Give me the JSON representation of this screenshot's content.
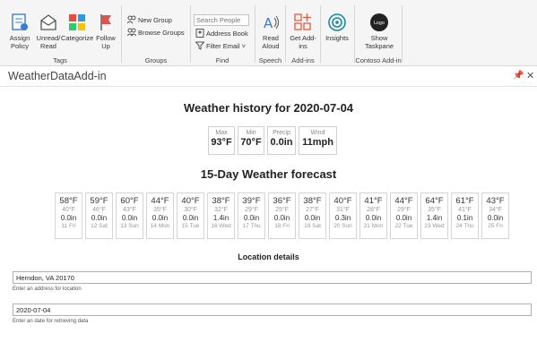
{
  "ribbon": {
    "tags": {
      "label": "Tags",
      "assign_policy": "Assign Policy",
      "unread_read": "Unread/ Read",
      "categorize": "Categorize",
      "follow_up": "Follow Up"
    },
    "groups": {
      "label": "Groups",
      "new_group": "New Group",
      "browse_groups": "Browse Groups"
    },
    "find": {
      "label": "Find",
      "search_placeholder": "Search People",
      "address_book": "Address Book",
      "filter_email": "Filter Email"
    },
    "speech": {
      "label": "Speech",
      "read_aloud": "Read Aloud"
    },
    "addins": {
      "label": "Add-ins",
      "get_addins": "Get Add-ins"
    },
    "insights": {
      "label": "Insights"
    },
    "contoso": {
      "label": "Contoso Add-in",
      "show_taskpane": "Show Taskpane",
      "logo_text": "Logo"
    }
  },
  "pane": {
    "title": "WeatherDataAdd-in"
  },
  "history": {
    "title": "Weather history for 2020-07-04",
    "stats": [
      {
        "label": "Max",
        "value": "93°F"
      },
      {
        "label": "Min",
        "value": "70°F"
      },
      {
        "label": "Precip",
        "value": "0.0in"
      },
      {
        "label": "Wind",
        "value": "11mph"
      }
    ]
  },
  "forecast": {
    "title": "15-Day Weather forecast",
    "days": [
      {
        "hi": "58°F",
        "lo": "40°F",
        "precip": "0.0in",
        "date": "11 Fri"
      },
      {
        "hi": "59°F",
        "lo": "46°F",
        "precip": "0.0in",
        "date": "12 Sat"
      },
      {
        "hi": "60°F",
        "lo": "43°F",
        "precip": "0.0in",
        "date": "13 Sun"
      },
      {
        "hi": "44°F",
        "lo": "35°F",
        "precip": "0.0in",
        "date": "14 Mon"
      },
      {
        "hi": "40°F",
        "lo": "30°F",
        "precip": "0.0in",
        "date": "15 Tue"
      },
      {
        "hi": "38°F",
        "lo": "32°F",
        "precip": "1.4in",
        "date": "16 Wed"
      },
      {
        "hi": "39°F",
        "lo": "29°F",
        "precip": "0.0in",
        "date": "17 Thu"
      },
      {
        "hi": "36°F",
        "lo": "25°F",
        "precip": "0.0in",
        "date": "18 Fri"
      },
      {
        "hi": "38°F",
        "lo": "27°F",
        "precip": "0.0in",
        "date": "19 Sat"
      },
      {
        "hi": "40°F",
        "lo": "31°F",
        "precip": "0.3in",
        "date": "20 Sun"
      },
      {
        "hi": "41°F",
        "lo": "28°F",
        "precip": "0.0in",
        "date": "21 Mon"
      },
      {
        "hi": "44°F",
        "lo": "29°F",
        "precip": "0.0in",
        "date": "22 Tue"
      },
      {
        "hi": "64°F",
        "lo": "35°F",
        "precip": "1.4in",
        "date": "23 Wed"
      },
      {
        "hi": "61°F",
        "lo": "41°F",
        "precip": "0.1in",
        "date": "24 Thu"
      },
      {
        "hi": "43°F",
        "lo": "34°F",
        "precip": "0.0in",
        "date": "25 Fri"
      }
    ]
  },
  "location": {
    "title": "Location details",
    "address_value": "Herndon, VA 20170",
    "address_hint": "Enter an address for location",
    "date_value": "2020-07-04",
    "date_hint": "Enter an date for retrieving data"
  },
  "colors": {
    "assign_policy": "#3a7bd5",
    "categorize": [
      "#e74c3c",
      "#3498db",
      "#2ecc71",
      "#f1c40f"
    ],
    "follow_up": "#d9534f",
    "get_addins": "#e35b3b",
    "insights": "#1a8a9c"
  }
}
